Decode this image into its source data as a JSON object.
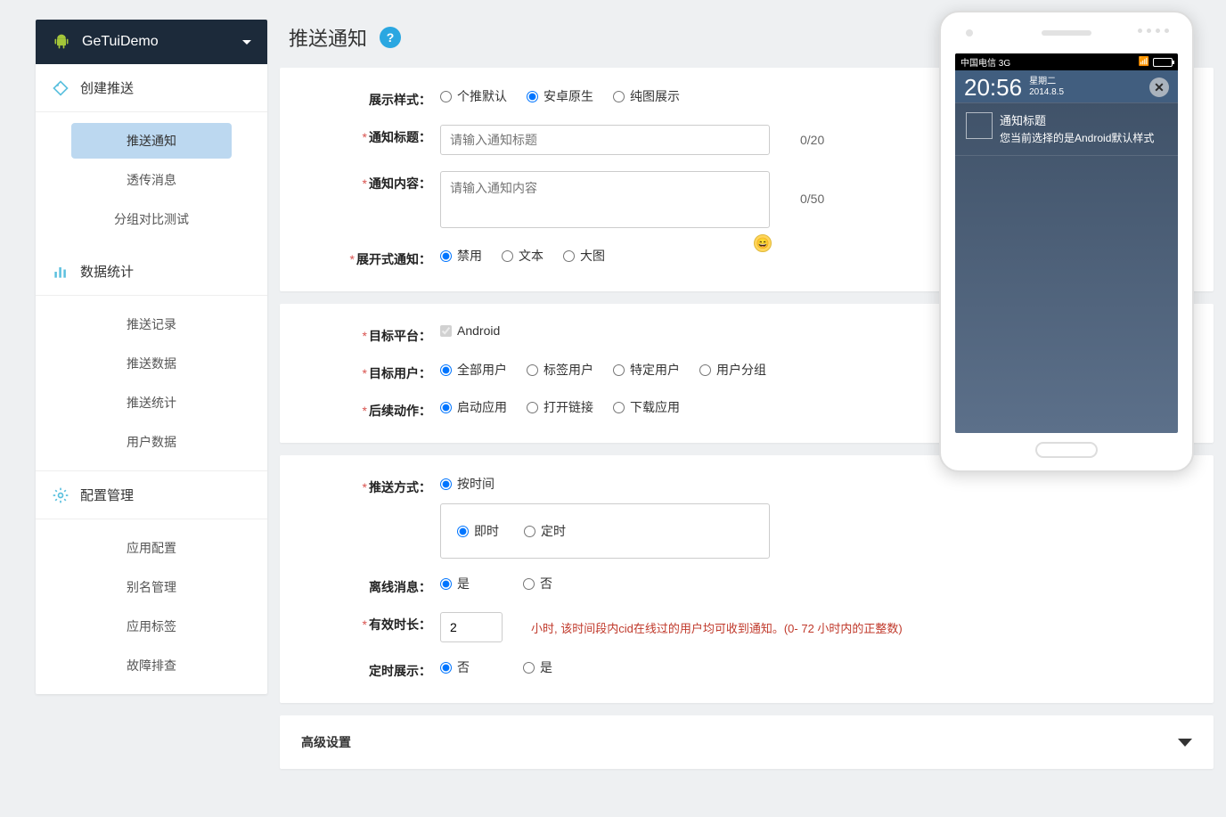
{
  "workspace": {
    "name": "GeTuiDemo"
  },
  "sidebar": {
    "groups": [
      {
        "title": "创建推送",
        "icon": "tag-icon",
        "iconColor": "#5bc0de",
        "items": [
          {
            "label": "推送通知",
            "active": true
          },
          {
            "label": "透传消息",
            "active": false
          },
          {
            "label": "分组对比测试",
            "active": false
          }
        ]
      },
      {
        "title": "数据统计",
        "icon": "bar-chart-icon",
        "iconColor": "#5bc0de",
        "items": [
          {
            "label": "推送记录"
          },
          {
            "label": "推送数据"
          },
          {
            "label": "推送统计"
          },
          {
            "label": "用户数据"
          }
        ]
      },
      {
        "title": "配置管理",
        "icon": "gear-icon",
        "iconColor": "#5bc0de",
        "items": [
          {
            "label": "应用配置"
          },
          {
            "label": "别名管理"
          },
          {
            "label": "应用标签"
          },
          {
            "label": "故障排查"
          }
        ]
      }
    ]
  },
  "page": {
    "title": "推送通知",
    "help": "?"
  },
  "form": {
    "displayStyle": {
      "label": "展示样式：",
      "options": [
        "个推默认",
        "安卓原生",
        "纯图展示"
      ],
      "selected": "安卓原生"
    },
    "title": {
      "label": "通知标题：",
      "placeholder": "请输入通知标题",
      "value": "",
      "counter": "0/20"
    },
    "content": {
      "label": "通知内容：",
      "placeholder": "请输入通知内容",
      "value": "",
      "counter": "0/50"
    },
    "expandable": {
      "label": "展开式通知：",
      "options": [
        "禁用",
        "文本",
        "大图"
      ],
      "selected": "禁用"
    },
    "platform": {
      "label": "目标平台：",
      "option": "Android",
      "checked": true
    },
    "targetUser": {
      "label": "目标用户：",
      "options": [
        "全部用户",
        "标签用户",
        "特定用户",
        "用户分组"
      ],
      "selected": "全部用户"
    },
    "afterAction": {
      "label": "后续动作：",
      "options": [
        "启动应用",
        "打开链接",
        "下载应用"
      ],
      "selected": "启动应用"
    },
    "pushMode": {
      "label": "推送方式：",
      "topOption": "按时间",
      "options": [
        "即时",
        "定时"
      ],
      "selected": "即时"
    },
    "offline": {
      "label": "离线消息：",
      "options": [
        "是",
        "否"
      ],
      "selected": "是"
    },
    "ttl": {
      "label": "有效时长：",
      "value": "2",
      "hint": "小时, 该时间段内cid在线过的用户均可收到通知。(0- 72 小时内的正整数)"
    },
    "scheduledShow": {
      "label": "定时展示：",
      "options": [
        "否",
        "是"
      ],
      "selected": "否"
    }
  },
  "advanced": {
    "label": "高级设置"
  },
  "phone": {
    "carrier": "中国电信 3G",
    "time": "20:56",
    "weekday": "星期二",
    "date": "2014.8.5",
    "notifTitle": "通知标题",
    "notifBody": "您当前选择的是Android默认样式"
  }
}
